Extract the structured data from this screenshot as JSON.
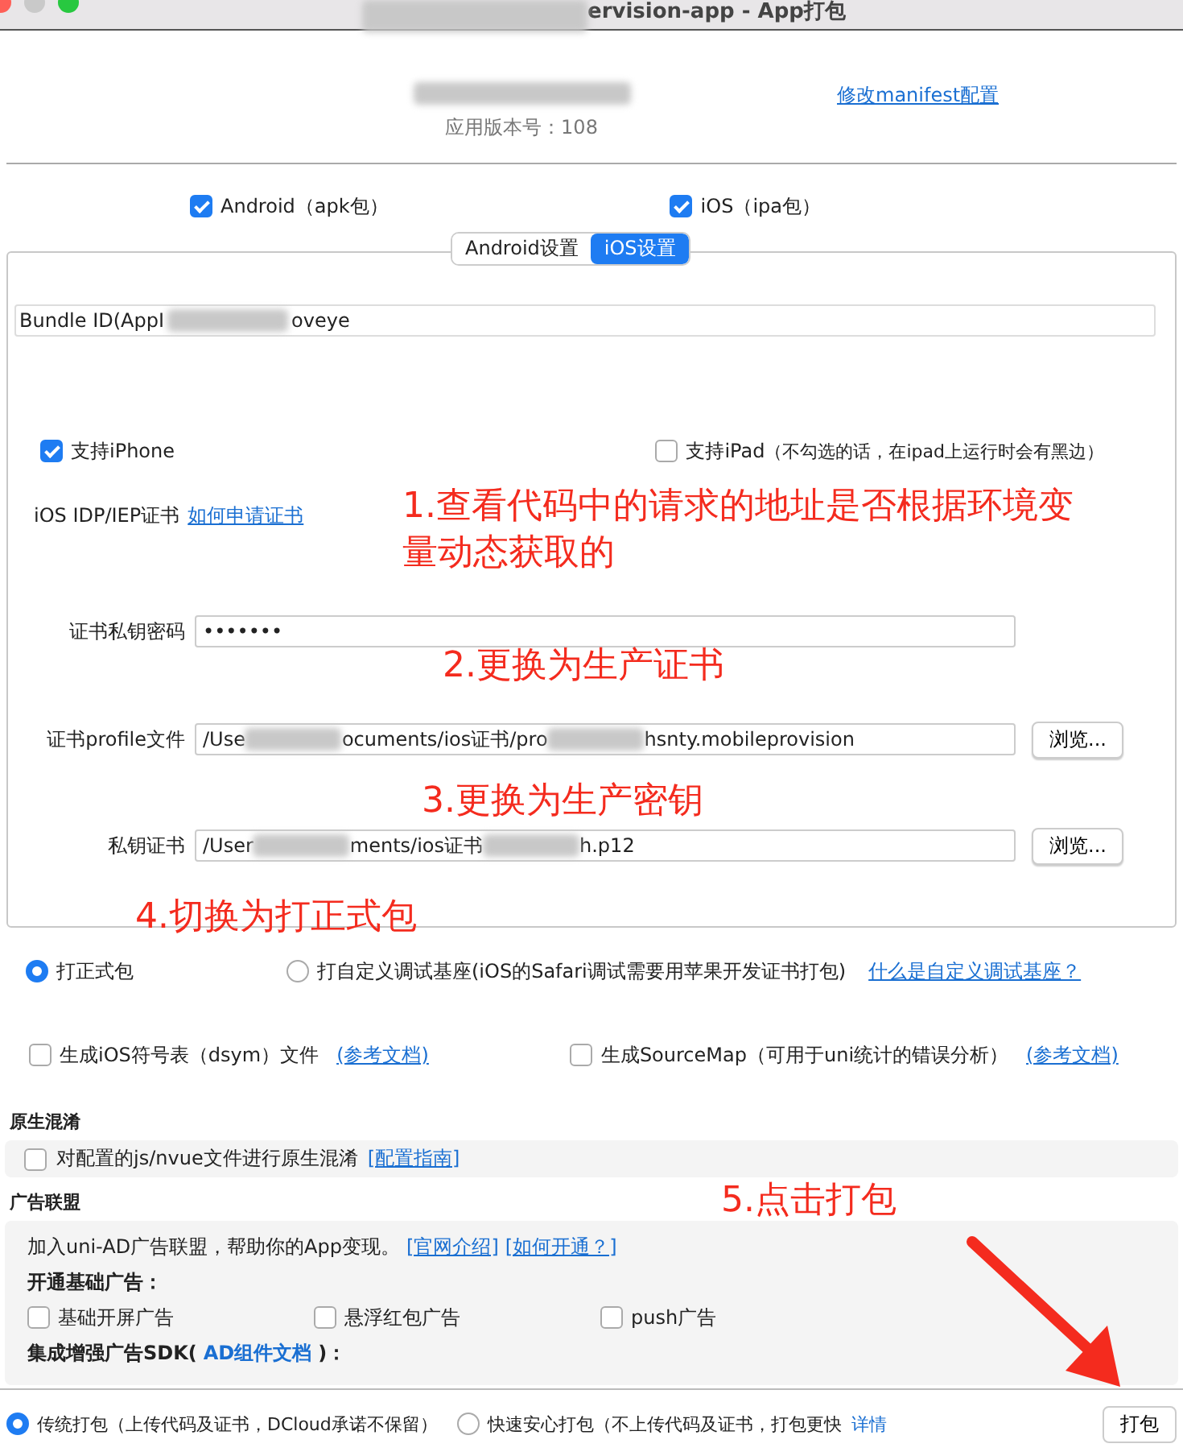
{
  "window": {
    "title": "ervision-app - App打包"
  },
  "header": {
    "version": "应用版本号：108",
    "manifest_link": "修改manifest配置"
  },
  "platforms": [
    {
      "label": "Android（apk包）",
      "checked": true
    },
    {
      "label": "iOS（ipa包）",
      "checked": true
    }
  ],
  "tabs": [
    {
      "label": "Android设置",
      "selected": false
    },
    {
      "label": "iOS设置",
      "selected": true
    }
  ],
  "ios": {
    "bundle_id": {
      "label": "Bundle ID(AppI",
      "value": "oveye"
    },
    "devices": [
      {
        "label": "支持iPhone",
        "checked": true
      },
      {
        "label": "支持iPad",
        "note": "（不勾选的话，在ipad上运行时会有黑边）",
        "checked": false
      }
    ],
    "cert": {
      "label": "iOS IDP/IEP证书",
      "link": "如何申请证书"
    },
    "fields": [
      {
        "label": "证书私钥密码",
        "kind": "password",
        "value_parts": [
          "•••••••"
        ]
      },
      {
        "label": "证书profile文件",
        "kind": "file",
        "value_parts": [
          "/Use",
          "ocuments/ios证书/pro",
          "hsnty.mobileprovision"
        ],
        "button": "浏览..."
      },
      {
        "label": "私钥证书",
        "kind": "file",
        "value_parts": [
          "/User",
          "ments/ios证书",
          "h.p12"
        ],
        "button": "浏览..."
      }
    ]
  },
  "build_types": [
    {
      "label": "打正式包",
      "selected": true
    },
    {
      "label": "打自定义调试基座(iOS的Safari调试需要用苹果开发证书打包)",
      "selected": false
    }
  ],
  "build_type_link": "什么是自定义调试基座？",
  "extras": [
    {
      "label": "生成iOS符号表（dsym）文件",
      "link": "(参考文档)",
      "checked": false
    },
    {
      "label": "生成SourceMap（可用于uni统计的错误分析）",
      "link": "(参考文档)",
      "checked": false
    }
  ],
  "obfuscation": {
    "title": "原生混淆",
    "label": "对配置的js/nvue文件进行原生混淆",
    "checked": false,
    "link": "[配置指南]"
  },
  "ads": {
    "title": "广告联盟",
    "intro": "加入uni-AD广告联盟，帮助你的App变现。",
    "links": [
      "[官网介绍]",
      "[如何开通？]"
    ],
    "basic_title": "开通基础广告：",
    "basic": [
      {
        "label": "基础开屏广告",
        "checked": false
      },
      {
        "label": "悬浮红包广告",
        "checked": false
      },
      {
        "label": "push广告",
        "checked": false
      }
    ],
    "sdk_prefix": "集成增强广告SDK(",
    "sdk_link": "AD组件文档",
    "sdk_suffix": ")："
  },
  "pack_modes": [
    {
      "label": "传统打包",
      "note": "（上传代码及证书，DCloud承诺不保留）",
      "selected": true
    },
    {
      "label": "快速安心打包",
      "note": "（不上传代码及证书，打包更快",
      "selected": false
    }
  ],
  "details_link": "详情",
  "pack_button": "打包",
  "annotations": [
    "1.查看代码中的请求的地址是否根据环境变量动态获取的",
    "2.更换为生产证书",
    "3.更换为生产密钥",
    "4.切换为打正式包",
    "5.点击打包"
  ]
}
